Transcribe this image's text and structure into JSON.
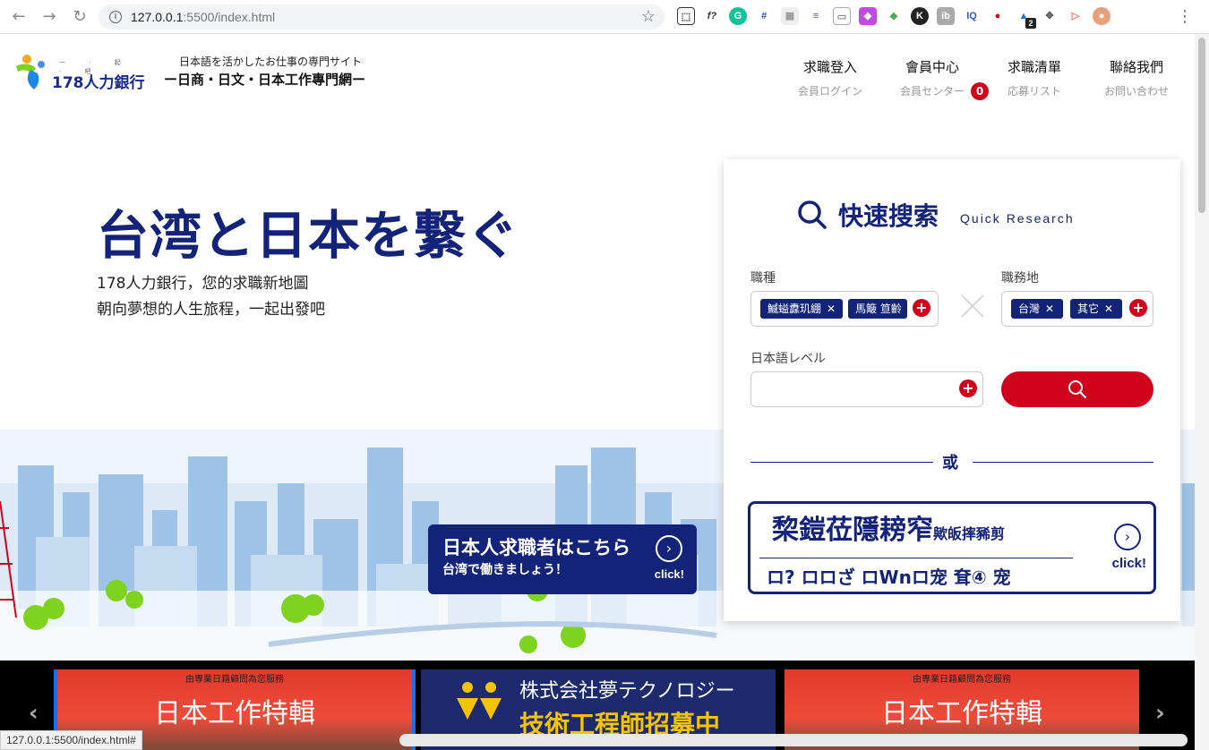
{
  "browser": {
    "url_host": "127.0.0.1",
    "url_path": ":5500/index.html",
    "ext_badge": "2",
    "status_url": "127.0.0.1:5500/index.html#"
  },
  "header": {
    "logo_text": "178人力銀行",
    "logo_small": "一 · 起 · 吧",
    "tagline_jp": "日本語を活かしたお仕事の専門サイト",
    "tagline_zh": "ー日商・日文・日本工作專門網ー",
    "nav": [
      {
        "main": "求職登入",
        "sub": "会員ログイン"
      },
      {
        "main": "會員中心",
        "sub": "会員センター"
      },
      {
        "main": "求職清單",
        "sub": "応募リスト",
        "badge": "0"
      },
      {
        "main": "聯絡我們",
        "sub": "お問い合わせ"
      }
    ]
  },
  "hero": {
    "title": "台湾と日本を繋ぐ",
    "sub1": "178人力銀行，您的求職新地圖",
    "sub2": "朝向夢想的人生旅程，一起出發吧"
  },
  "jp_button": {
    "title": "日本人求職者はこちら",
    "sub": "台湾で働きましょう！",
    "click": "click!"
  },
  "search": {
    "title": "快速搜索",
    "title_en": "Quick Research",
    "job_label": "職種",
    "job_chips": [
      "鰄螠纛玑綳",
      "馬簸 笪齡"
    ],
    "location_label": "職務地",
    "location_chips": [
      "台灣",
      "其它"
    ],
    "level_label": "日本語レベル",
    "or_text": "或",
    "tw_title": "棃鎧莅隱耪窄",
    "tw_title_small": "歟皈摔豨剪",
    "tw_sub": "ロ? ロロざ ロWnロ宠 耷④ 宠",
    "tw_click": "click!"
  },
  "carousel": {
    "banner1_top": "由專業日籍顧問為您服務",
    "banner1_main": "日本工作特輯",
    "banner2_line1": "株式会社夢テクノロジー",
    "banner2_line2": "技術工程師招募中",
    "banner3_top": "由專業日籍顧問為您服務",
    "banner3_main": "日本工作特輯",
    "prev": "‹",
    "next": "›"
  },
  "colors": {
    "navy": "#13237a",
    "red": "#d0021b"
  }
}
